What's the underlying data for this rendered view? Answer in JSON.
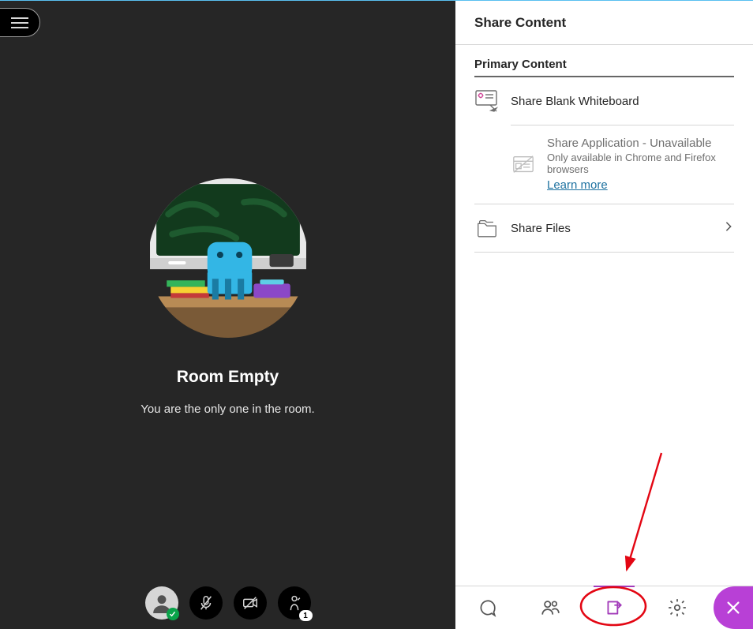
{
  "main": {
    "title": "Room Empty",
    "subtitle": "You are the only one in the room."
  },
  "controls": {
    "participant_count": "1"
  },
  "panel": {
    "header": "Share Content",
    "section": "Primary Content",
    "whiteboard": {
      "title": "Share Blank Whiteboard"
    },
    "application": {
      "title": "Share Application - Unavailable",
      "sub": "Only available in Chrome and Firefox browsers",
      "link": "Learn more"
    },
    "files": {
      "title": "Share Files"
    }
  }
}
